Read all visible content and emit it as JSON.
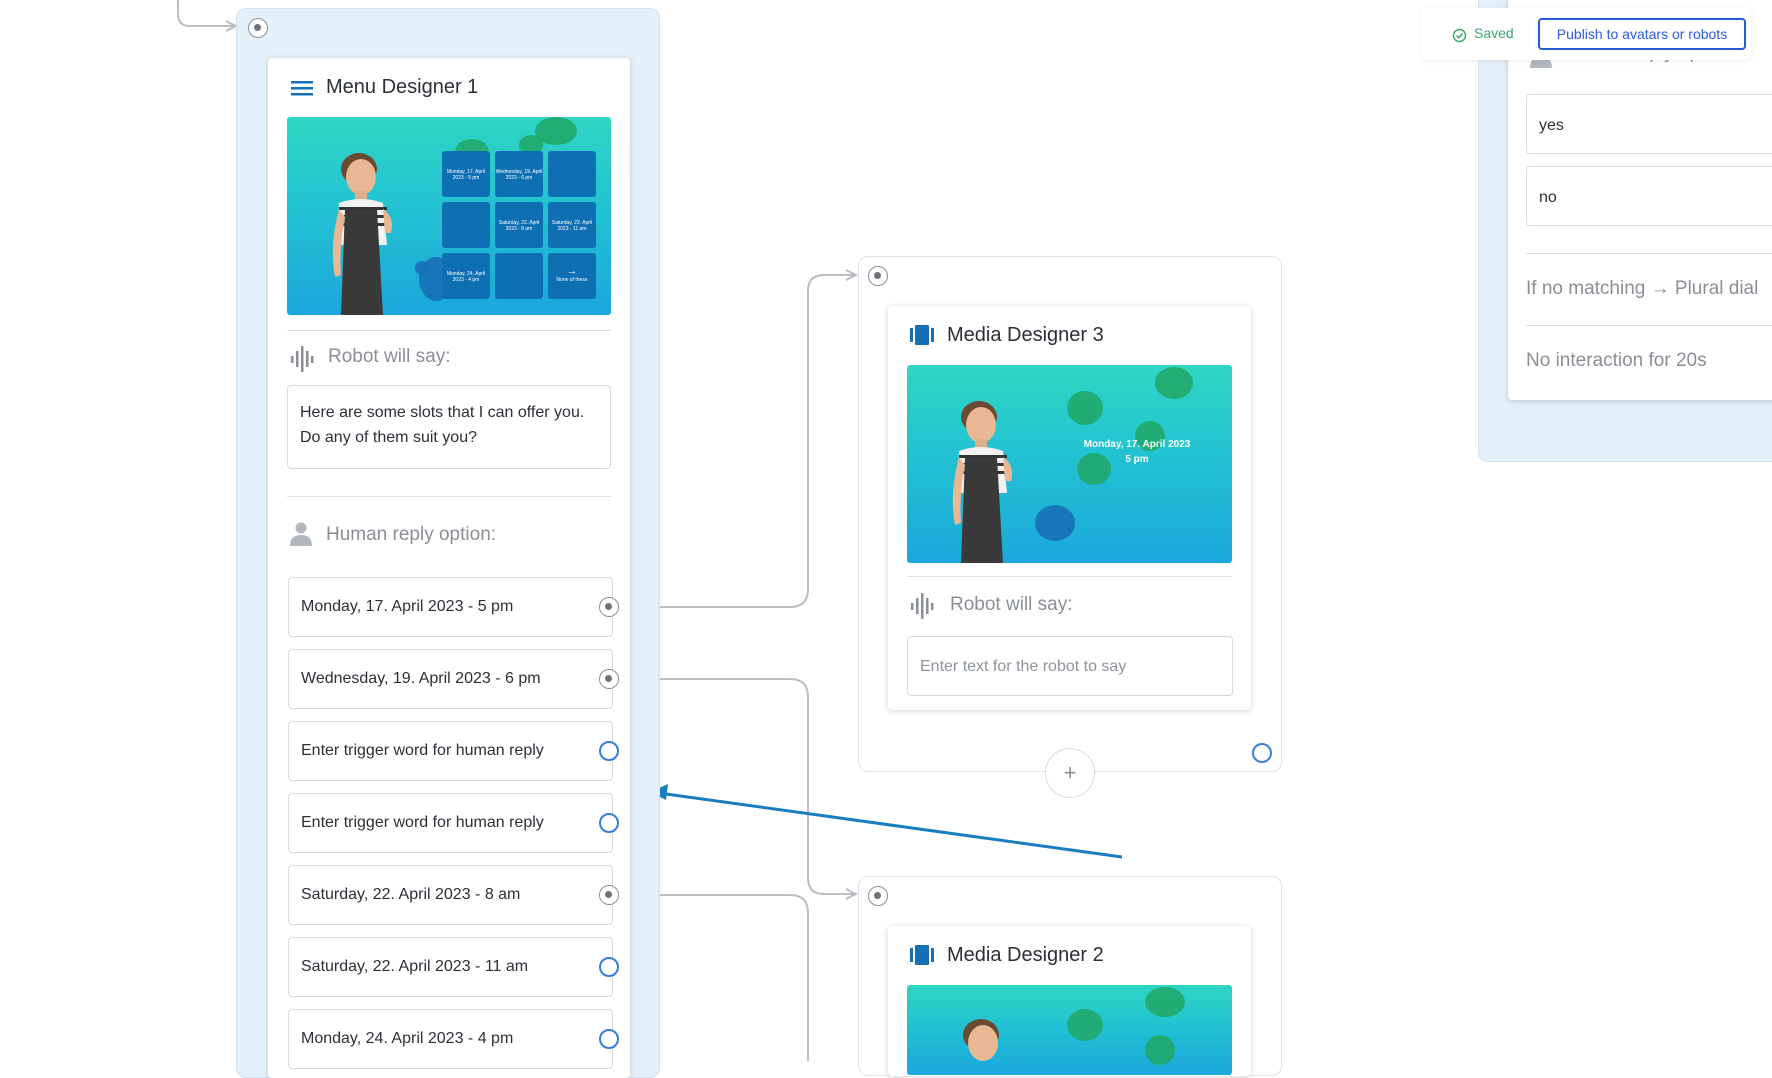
{
  "header": {
    "saved_label": "Saved",
    "publish_label": "Publish to avatars or robots"
  },
  "menu_designer": {
    "title": "Menu Designer 1",
    "robot_label": "Robot will say:",
    "robot_text": "Here are some slots that I can offer you. Do any of them suit you?",
    "human_label": "Human reply option:",
    "tiles": [
      "Monday, 17. April 2023 - 5 pm",
      "Wednesday, 19. April 2023 - 6 pm",
      "",
      "",
      "Saturday, 22. April 2023 - 8 am",
      "Saturday, 22. April 2023 - 11 am",
      "Monday, 24. April 2023 - 4 pm",
      "",
      "None of these"
    ],
    "replies": [
      {
        "text": "Monday, 17. April 2023 - 5 pm",
        "placeholder": false
      },
      {
        "text": "Wednesday, 19. April 2023 - 6 pm",
        "placeholder": false
      },
      {
        "text": "Enter trigger word for human reply",
        "placeholder": true
      },
      {
        "text": "Enter trigger word for human reply",
        "placeholder": true
      },
      {
        "text": "Saturday, 22. April 2023 - 8 am",
        "placeholder": false
      },
      {
        "text": "Saturday, 22. April 2023 - 11 am",
        "placeholder": false
      },
      {
        "text": "Monday, 24. April 2023 - 4 pm",
        "placeholder": false
      }
    ]
  },
  "media_designer_3": {
    "title": "Media Designer 3",
    "image_text": "Monday, 17. April 2023\n5 pm",
    "robot_label": "Robot will say:",
    "robot_placeholder": "Enter text for the robot to say",
    "add_button": "+"
  },
  "media_designer_2": {
    "title": "Media Designer 2"
  },
  "right_panel": {
    "human_label": "Human reply option:",
    "replies": [
      "yes",
      "no"
    ],
    "no_match": "If no matching → Plural dial",
    "no_interaction": "No interaction for 20s"
  },
  "colors": {
    "group_bg": "#e3f0fa",
    "accent_blue": "#3b7be0",
    "publish_blue": "#2a5bd7",
    "saved_green": "#3aa76d",
    "arrow_blue": "#1a7dc0"
  }
}
